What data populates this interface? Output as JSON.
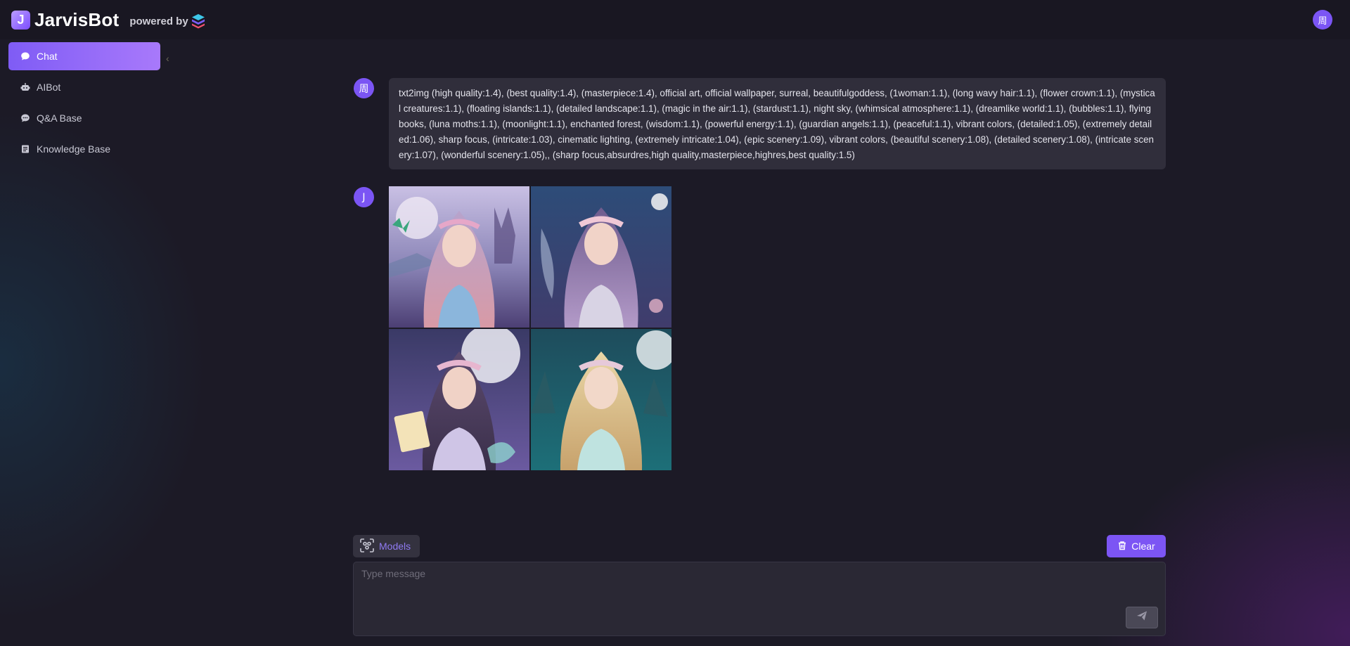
{
  "header": {
    "logo_letter": "J",
    "app_title": "JarvisBot",
    "powered_by": "powered by",
    "user_avatar": "周"
  },
  "sidebar": {
    "items": [
      {
        "label": "Chat",
        "icon": "chat-bubble-icon",
        "active": true
      },
      {
        "label": "AIBot",
        "icon": "robot-icon",
        "active": false
      },
      {
        "label": "Q&A Base",
        "icon": "qa-bubble-icon",
        "active": false
      },
      {
        "label": "Knowledge Base",
        "icon": "book-icon",
        "active": false
      }
    ],
    "collapse_glyph": "‹"
  },
  "chat": {
    "messages": [
      {
        "role": "user",
        "avatar": "周",
        "text": "txt2img (high quality:1.4), (best quality:1.4), (masterpiece:1.4), official art, official wallpaper, surreal, beautifulgoddess, (1woman:1.1), (long wavy hair:1.1), (flower crown:1.1), (mystical creatures:1.1), (floating islands:1.1), (detailed landscape:1.1), (magic in the air:1.1), (stardust:1.1), night sky, (whimsical atmosphere:1.1), (dreamlike world:1.1), (bubbles:1.1), flying books, (luna moths:1.1), (moonlight:1.1), enchanted forest, (wisdom:1.1), (powerful energy:1.1), (guardian angels:1.1), (peaceful:1.1), vibrant colors, (detailed:1.05), (extremely detailed:1.06), sharp focus, (intricate:1.03), cinematic lighting, (extremely intricate:1.04), (epic scenery:1.09), vibrant colors, (beautiful scenery:1.08), (detailed scenery:1.08), (intricate scenery:1.07), (wonderful scenery:1.05),, (sharp focus,absurdres,high quality,masterpiece,highres,best quality:1.5)"
      },
      {
        "role": "bot",
        "avatar": "J",
        "images": [
          "fairy-portrait-1",
          "fairy-portrait-2",
          "fairy-portrait-3",
          "fairy-portrait-4"
        ]
      }
    ]
  },
  "composer": {
    "models_label": "Models",
    "clear_label": "Clear",
    "placeholder": "Type message",
    "value": ""
  },
  "colors": {
    "accent": "#7c55f4",
    "background": "#1c1a26",
    "header": "#191722",
    "bubble": "#302e3b"
  }
}
